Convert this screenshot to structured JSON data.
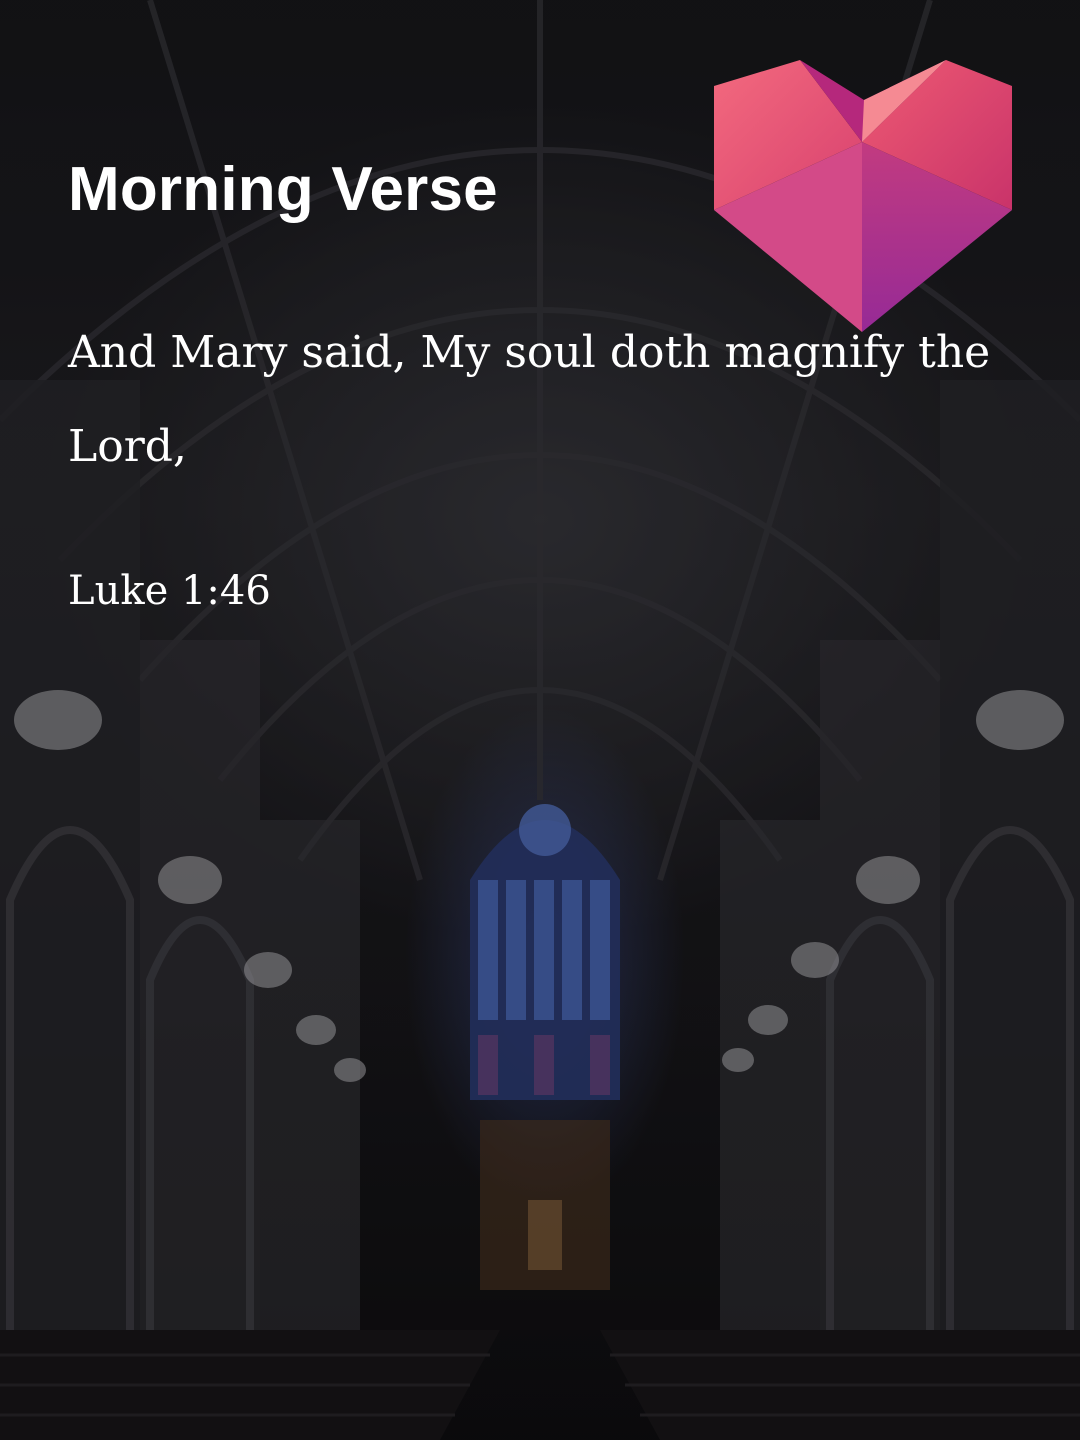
{
  "screen": {
    "title": "Morning Verse",
    "verse_text": "And Mary said, My soul doth magnify the Lord,",
    "verse_reference": "Luke 1:46",
    "heart_icon": "heart-icon",
    "background": "cathedral-interior-image"
  },
  "colors": {
    "text": "#ffffff",
    "heart_light": "#f0647a",
    "heart_mid": "#d6386f",
    "heart_dark": "#a32a8f"
  }
}
